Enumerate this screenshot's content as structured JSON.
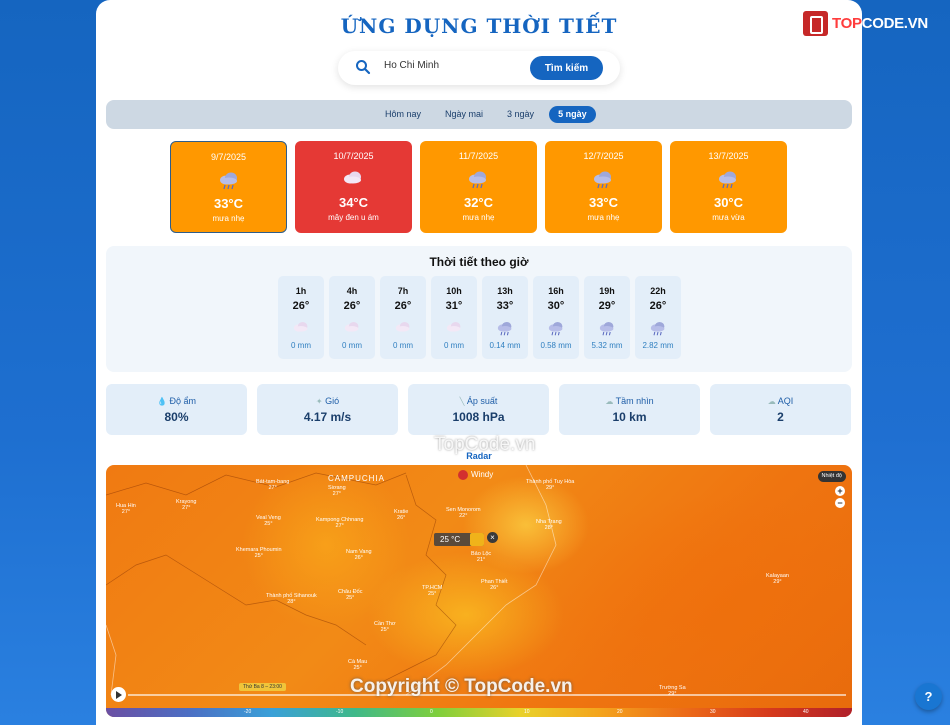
{
  "app_title": "ỨNG DỤNG THỜI TIẾT",
  "search": {
    "value": "Ho Chi Minh",
    "button_label": "Tìm kiếm"
  },
  "tabs": [
    {
      "label": "Hôm nay",
      "active": false
    },
    {
      "label": "Ngày mai",
      "active": false
    },
    {
      "label": "3 ngày",
      "active": false
    },
    {
      "label": "5 ngày",
      "active": true
    }
  ],
  "daily": [
    {
      "date": "9/7/2025",
      "temp": "33°C",
      "desc": "mưa nhẹ",
      "icon": "rain-cloud-icon",
      "color": "#ff9800",
      "selected": true
    },
    {
      "date": "10/7/2025",
      "temp": "34°C",
      "desc": "mây đen u ám",
      "icon": "cloud-icon",
      "color": "#e53935",
      "selected": false
    },
    {
      "date": "11/7/2025",
      "temp": "32°C",
      "desc": "mưa nhẹ",
      "icon": "rain-cloud-icon",
      "color": "#ff9800",
      "selected": false
    },
    {
      "date": "12/7/2025",
      "temp": "33°C",
      "desc": "mưa nhẹ",
      "icon": "rain-cloud-icon",
      "color": "#ff9800",
      "selected": false
    },
    {
      "date": "13/7/2025",
      "temp": "30°C",
      "desc": "mưa vừa",
      "icon": "rain-cloud-icon",
      "color": "#ff9800",
      "selected": false
    }
  ],
  "hourly": {
    "title": "Thời tiết theo giờ",
    "items": [
      {
        "hour": "1h",
        "temp": "26°",
        "rain": "0 mm",
        "icon": "cloud-icon"
      },
      {
        "hour": "4h",
        "temp": "26°",
        "rain": "0 mm",
        "icon": "cloud-icon"
      },
      {
        "hour": "7h",
        "temp": "26°",
        "rain": "0 mm",
        "icon": "cloud-icon"
      },
      {
        "hour": "10h",
        "temp": "31°",
        "rain": "0 mm",
        "icon": "cloud-icon"
      },
      {
        "hour": "13h",
        "temp": "33°",
        "rain": "0.14 mm",
        "icon": "rain-cloud-icon"
      },
      {
        "hour": "16h",
        "temp": "30°",
        "rain": "0.58 mm",
        "icon": "rain-cloud-icon"
      },
      {
        "hour": "19h",
        "temp": "29°",
        "rain": "5.32 mm",
        "icon": "rain-cloud-icon"
      },
      {
        "hour": "22h",
        "temp": "26°",
        "rain": "2.82 mm",
        "icon": "rain-cloud-icon"
      }
    ]
  },
  "stats": [
    {
      "label": "Độ ẩm",
      "value": "80%",
      "icon": "droplet-icon"
    },
    {
      "label": "Gió",
      "value": "4.17 m/s",
      "icon": "wind-icon"
    },
    {
      "label": "Áp suất",
      "value": "1008 hPa",
      "icon": "thermometer-icon"
    },
    {
      "label": "Tầm nhìn",
      "value": "10 km",
      "icon": "fog-icon"
    },
    {
      "label": "AQI",
      "value": "2",
      "icon": "cloud-icon"
    }
  ],
  "radar": {
    "title": "Radar",
    "provider": "Windy",
    "overlay_label": "Nhiệt độ",
    "pointer_temp": "25 °C",
    "country_label": "CAMPUCHIA",
    "timeline_label": "Thứ Ba 8 – 23:00",
    "scale_ticks": [
      "-20",
      "-10",
      "0",
      "10",
      "20",
      "30",
      "40"
    ],
    "places": [
      {
        "name": "Bát-tam-bang",
        "temp": "27°"
      },
      {
        "name": "Siơang",
        "temp": "27°"
      },
      {
        "name": "Krayong",
        "temp": "27°"
      },
      {
        "name": "Hua Hin",
        "temp": "27°"
      },
      {
        "name": "Veal Veng",
        "temp": "25°"
      },
      {
        "name": "Kampong Chhnang",
        "temp": "27°"
      },
      {
        "name": "Kratie",
        "temp": "26°"
      },
      {
        "name": "Sen Monorom",
        "temp": "22°"
      },
      {
        "name": "Thành phố Tuy Hòa",
        "temp": "29°"
      },
      {
        "name": "Nha Trang",
        "temp": "28°"
      },
      {
        "name": "Khemara Phoumin",
        "temp": "25°"
      },
      {
        "name": "Nam Vang",
        "temp": "26°"
      },
      {
        "name": "Bảo Lộc",
        "temp": "21°"
      },
      {
        "name": "Phan Thiết",
        "temp": "26°"
      },
      {
        "name": "Thành phố Sihanouk",
        "temp": "28°"
      },
      {
        "name": "Châu Đốc",
        "temp": "25°"
      },
      {
        "name": "TP.HCM",
        "temp": "25°"
      },
      {
        "name": "Cần Thơ",
        "temp": "25°"
      },
      {
        "name": "Kalayaan",
        "temp": "29°"
      },
      {
        "name": "Cà Mau",
        "temp": "25°"
      },
      {
        "name": "Trường Sa",
        "temp": "29°"
      }
    ]
  },
  "watermark_top": "TopCode.vn",
  "watermark_bottom": "Copyright © TopCode.vn",
  "logo": {
    "prefix": "TOP",
    "suffix": "CODE.VN"
  },
  "help_label": "?"
}
